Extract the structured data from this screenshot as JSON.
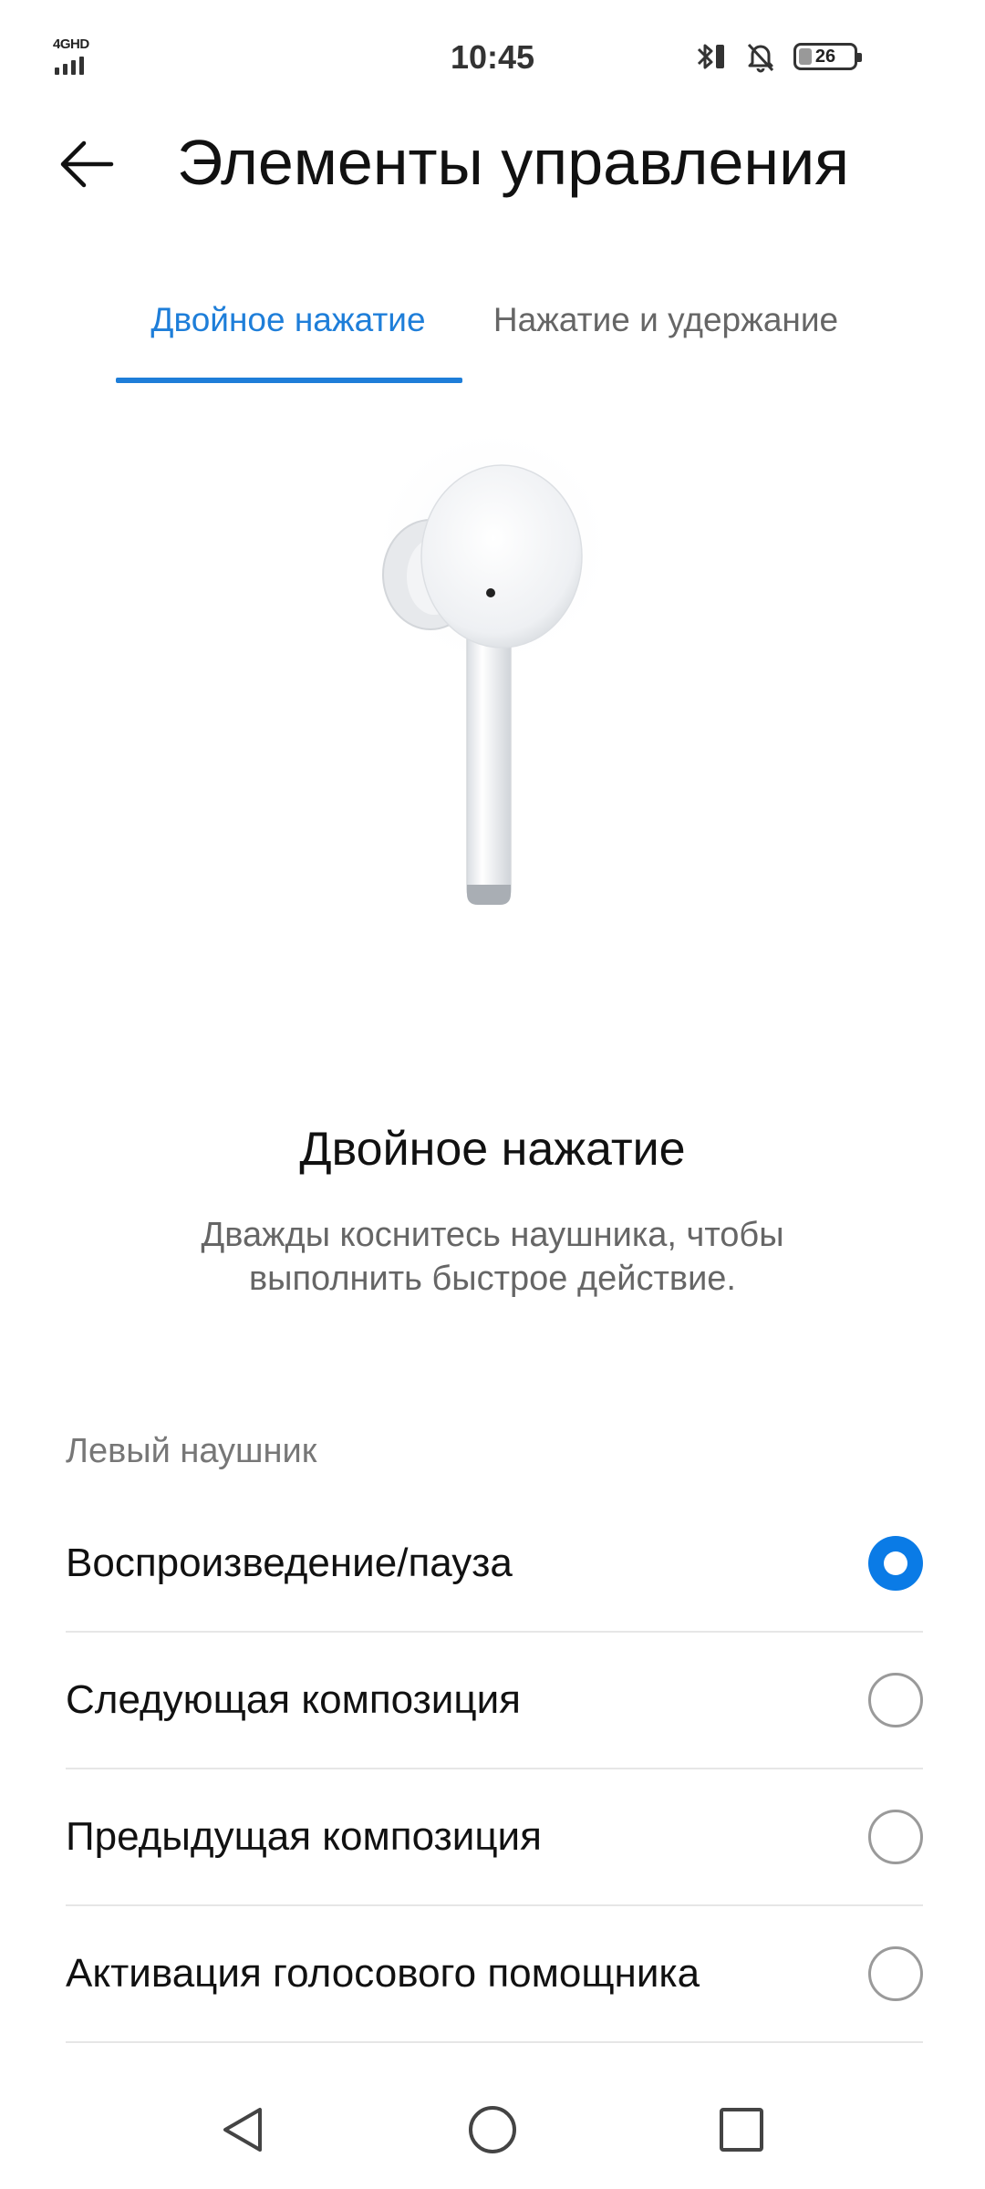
{
  "status_bar": {
    "network": "4GHD",
    "time": "10:45",
    "battery_level": "26",
    "battery_fraction": 0.26
  },
  "header": {
    "title": "Элементы управления"
  },
  "tabs": [
    {
      "label": "Двойное нажатие",
      "active": true
    },
    {
      "label": "Нажатие и удержание",
      "active": false
    }
  ],
  "section": {
    "title": "Двойное нажатие",
    "description": "Дважды коснитесь наушника, чтобы выполнить быстрое действие."
  },
  "left_earbud": {
    "label": "Левый наушник",
    "options": [
      {
        "label": "Воспроизведение/пауза",
        "selected": true
      },
      {
        "label": "Следующая композиция",
        "selected": false
      },
      {
        "label": "Предыдущая композиция",
        "selected": false
      },
      {
        "label": "Активация голосового помощника",
        "selected": false
      }
    ]
  },
  "colors": {
    "accent": "#1e7ed9",
    "radio_selected": "#0a7be6"
  }
}
